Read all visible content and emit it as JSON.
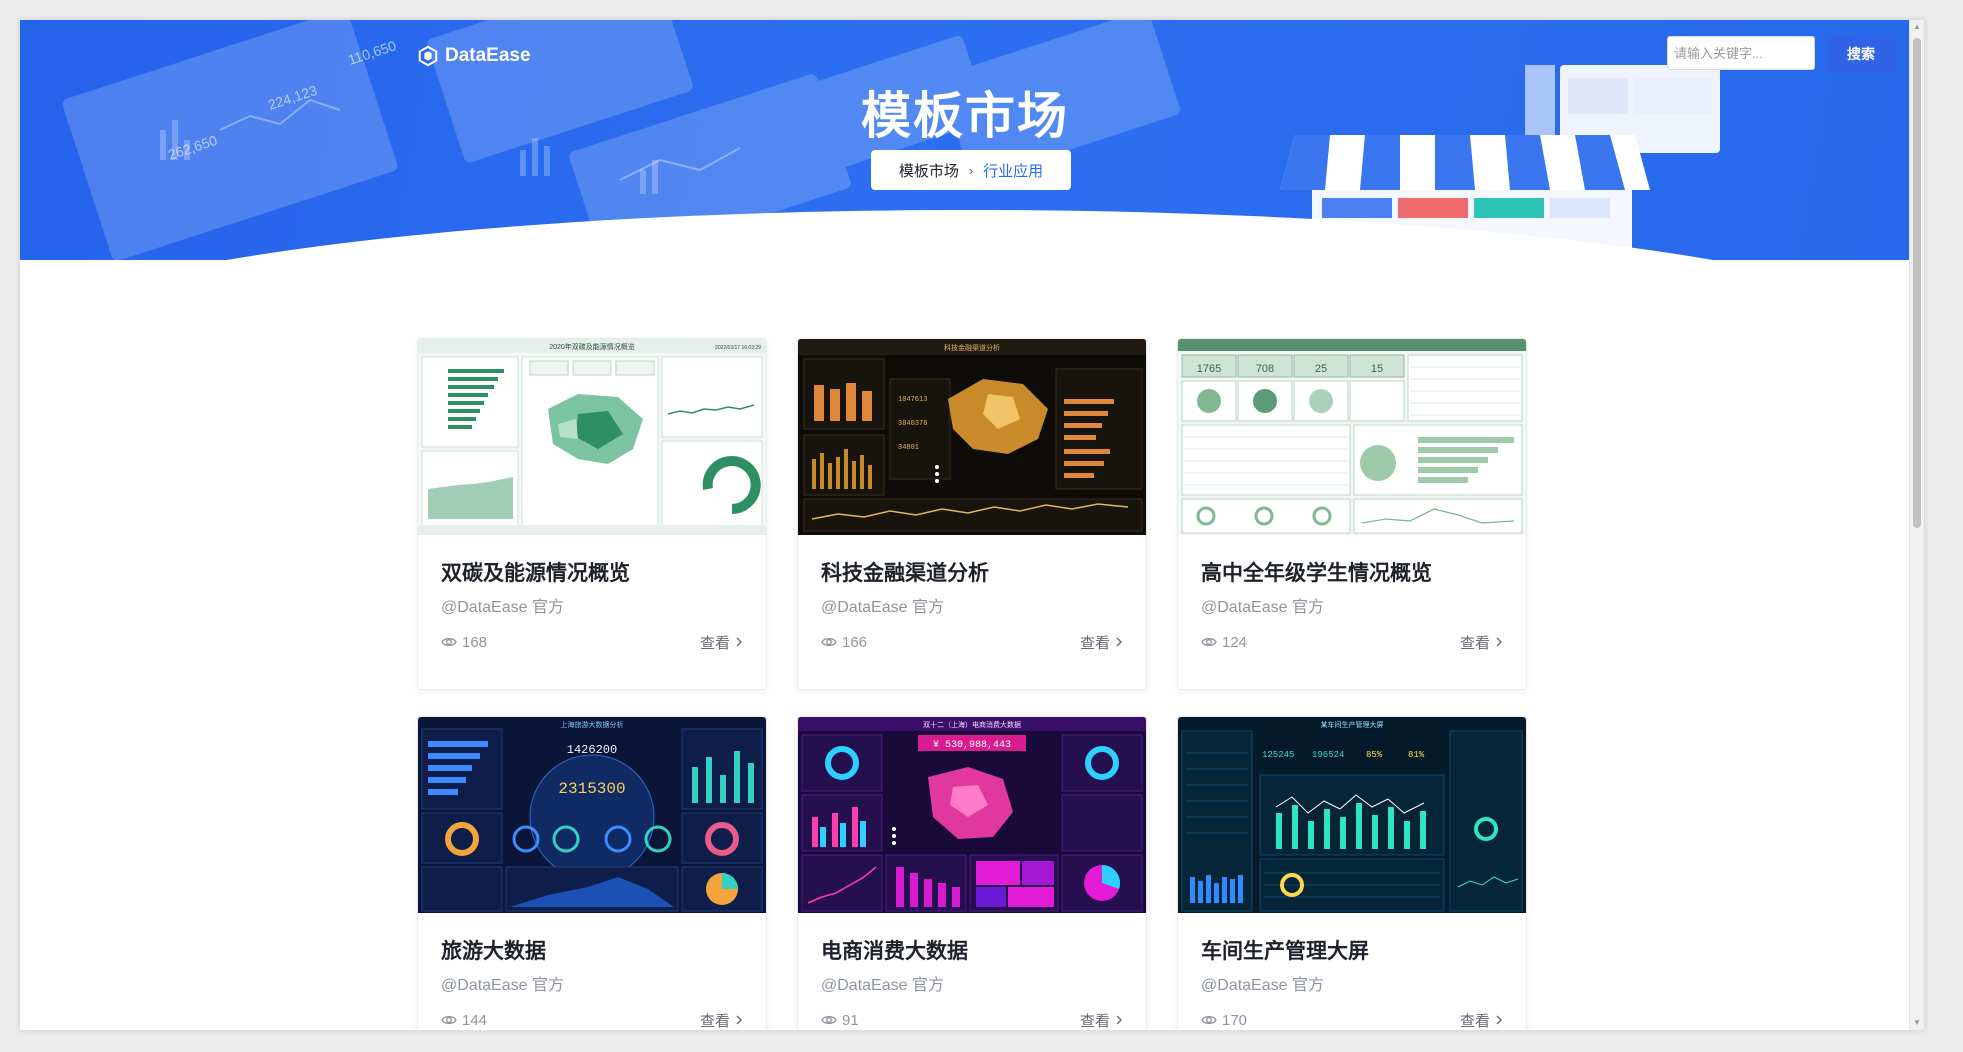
{
  "brand": {
    "name": "DataEase"
  },
  "hero": {
    "title": "模板市场",
    "breadcrumb": {
      "root": "模板市场",
      "separator": "›",
      "current": "行业应用"
    }
  },
  "search": {
    "placeholder": "请输入关键字...",
    "button": "搜索"
  },
  "cards": [
    {
      "title": "双碳及能源情况概览",
      "author": "@DataEase 官方",
      "views": "168",
      "link": "查看"
    },
    {
      "title": "科技金融渠道分析",
      "author": "@DataEase 官方",
      "views": "166",
      "link": "查看"
    },
    {
      "title": "高中全年级学生情况概览",
      "author": "@DataEase 官方",
      "views": "124",
      "link": "查看"
    },
    {
      "title": "旅游大数据",
      "author": "@DataEase 官方",
      "views": "144",
      "link": "查看"
    },
    {
      "title": "电商消费大数据",
      "author": "@DataEase 官方",
      "views": "91",
      "link": "查看"
    },
    {
      "title": "车间生产管理大屏",
      "author": "@DataEase 官方",
      "views": "170",
      "link": "查看"
    }
  ],
  "thumbnails": {
    "t1": {
      "header": "2020年双碳及能源情况概览",
      "date": "2022/03/17 16:03:29"
    },
    "t2": {
      "header": "科技金融渠道分析"
    },
    "t3": {
      "kpis": [
        "1765",
        "708",
        "25",
        "15"
      ]
    },
    "t4": {
      "header": "上海旅游大数据分析",
      "big1": "1426200",
      "big2": "2315300"
    },
    "t5": {
      "header": "双十二（上海）电商消费大数据",
      "amount": "¥ 530,988,443"
    },
    "t6": {
      "header": "某车间生产管理大屏",
      "kpis": [
        "125245",
        "196524",
        "85%",
        "81%"
      ]
    }
  },
  "colors": {
    "primary": "#2b6df0",
    "hero": "#2563eb",
    "muted": "#8f959e"
  }
}
